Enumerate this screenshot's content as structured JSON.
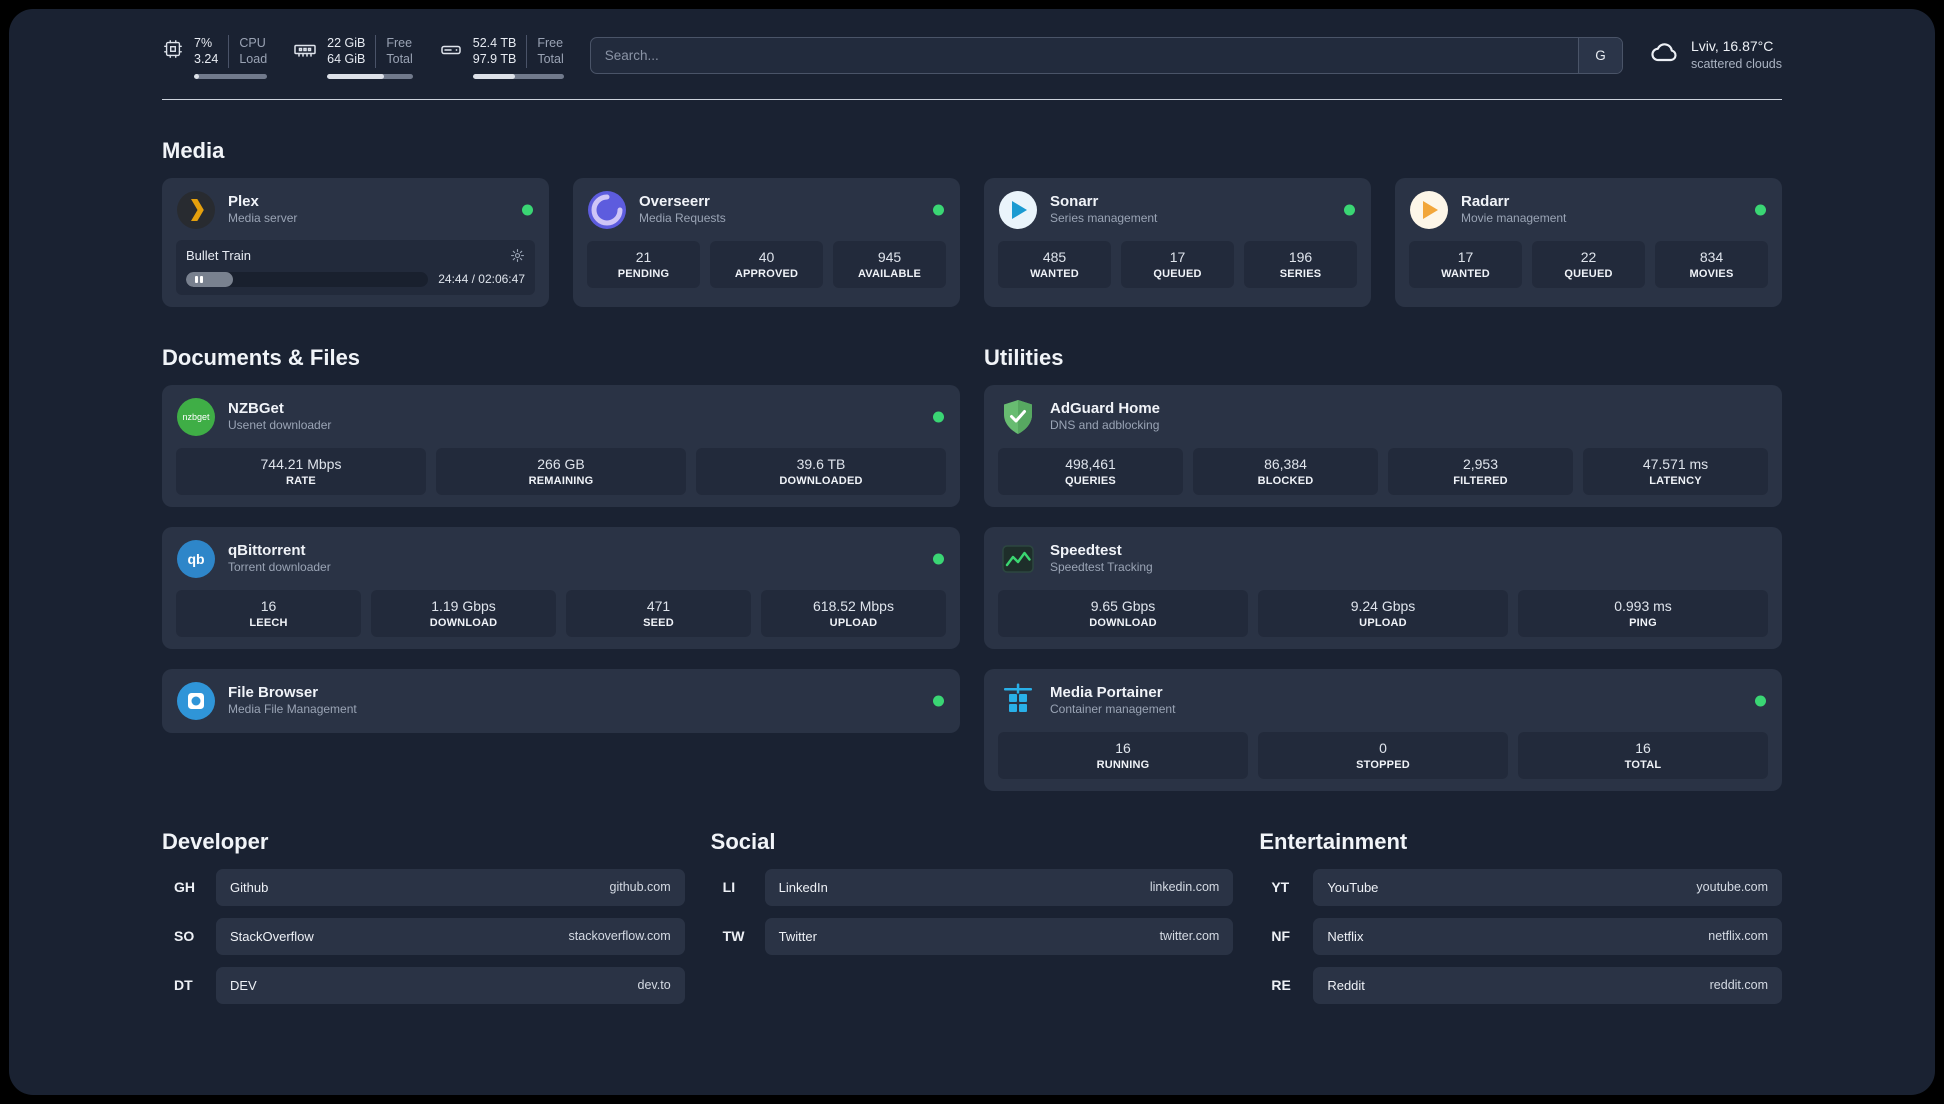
{
  "topbar": {
    "cpu": {
      "value1": "7%",
      "value2": "3.24",
      "label1": "CPU",
      "label2": "Load",
      "bar_percent": 7
    },
    "ram": {
      "value1": "22 GiB",
      "value2": "64 GiB",
      "label1": "Free",
      "label2": "Total",
      "bar_percent": 66
    },
    "disk": {
      "value1": "52.4 TB",
      "value2": "97.9 TB",
      "label1": "Free",
      "label2": "Total",
      "bar_percent": 46
    },
    "search": {
      "placeholder": "Search...",
      "button": "G"
    },
    "weather": {
      "location": "Lviv, 16.87°C",
      "condition": "scattered clouds"
    }
  },
  "sections": {
    "media": "Media",
    "documents": "Documents & Files",
    "utilities": "Utilities",
    "developer": "Developer",
    "social": "Social",
    "entertainment": "Entertainment"
  },
  "apps": {
    "plex": {
      "name": "Plex",
      "subtitle": "Media server",
      "now_playing": "Bullet Train",
      "time": "24:44 / 02:06:47",
      "progress_percent": 19.5
    },
    "overseerr": {
      "name": "Overseerr",
      "subtitle": "Media Requests",
      "stats": [
        {
          "value": "21",
          "label": "PENDING"
        },
        {
          "value": "40",
          "label": "APPROVED"
        },
        {
          "value": "945",
          "label": "AVAILABLE"
        }
      ]
    },
    "sonarr": {
      "name": "Sonarr",
      "subtitle": "Series management",
      "stats": [
        {
          "value": "485",
          "label": "WANTED"
        },
        {
          "value": "17",
          "label": "QUEUED"
        },
        {
          "value": "196",
          "label": "SERIES"
        }
      ]
    },
    "radarr": {
      "name": "Radarr",
      "subtitle": "Movie management",
      "stats": [
        {
          "value": "17",
          "label": "WANTED"
        },
        {
          "value": "22",
          "label": "QUEUED"
        },
        {
          "value": "834",
          "label": "MOVIES"
        }
      ]
    },
    "nzbget": {
      "name": "NZBGet",
      "subtitle": "Usenet downloader",
      "stats": [
        {
          "value": "744.21 Mbps",
          "label": "RATE"
        },
        {
          "value": "266 GB",
          "label": "REMAINING"
        },
        {
          "value": "39.6 TB",
          "label": "DOWNLOADED"
        }
      ]
    },
    "qbittorrent": {
      "name": "qBittorrent",
      "subtitle": "Torrent downloader",
      "stats": [
        {
          "value": "16",
          "label": "LEECH"
        },
        {
          "value": "1.19 Gbps",
          "label": "DOWNLOAD"
        },
        {
          "value": "471",
          "label": "SEED"
        },
        {
          "value": "618.52 Mbps",
          "label": "UPLOAD"
        }
      ]
    },
    "filebrowser": {
      "name": "File Browser",
      "subtitle": "Media File Management"
    },
    "adguard": {
      "name": "AdGuard Home",
      "subtitle": "DNS and adblocking",
      "stats": [
        {
          "value": "498,461",
          "label": "QUERIES"
        },
        {
          "value": "86,384",
          "label": "BLOCKED"
        },
        {
          "value": "2,953",
          "label": "FILTERED"
        },
        {
          "value": "47.571 ms",
          "label": "LATENCY"
        }
      ]
    },
    "speedtest": {
      "name": "Speedtest",
      "subtitle": "Speedtest Tracking",
      "stats": [
        {
          "value": "9.65 Gbps",
          "label": "DOWNLOAD"
        },
        {
          "value": "9.24 Gbps",
          "label": "UPLOAD"
        },
        {
          "value": "0.993 ms",
          "label": "PING"
        }
      ]
    },
    "portainer": {
      "name": "Media Portainer",
      "subtitle": "Container management",
      "stats": [
        {
          "value": "16",
          "label": "RUNNING"
        },
        {
          "value": "0",
          "label": "STOPPED"
        },
        {
          "value": "16",
          "label": "TOTAL"
        }
      ]
    }
  },
  "bookmarks": {
    "developer": [
      {
        "abbr": "GH",
        "name": "Github",
        "url": "github.com"
      },
      {
        "abbr": "SO",
        "name": "StackOverflow",
        "url": "stackoverflow.com"
      },
      {
        "abbr": "DT",
        "name": "DEV",
        "url": "dev.to"
      }
    ],
    "social": [
      {
        "abbr": "LI",
        "name": "LinkedIn",
        "url": "linkedin.com"
      },
      {
        "abbr": "TW",
        "name": "Twitter",
        "url": "twitter.com"
      }
    ],
    "entertainment": [
      {
        "abbr": "YT",
        "name": "YouTube",
        "url": "youtube.com"
      },
      {
        "abbr": "NF",
        "name": "Netflix",
        "url": "netflix.com"
      },
      {
        "abbr": "RE",
        "name": "Reddit",
        "url": "reddit.com"
      }
    ]
  },
  "colors": {
    "status_online": "#3ad674",
    "accent_plex": "#e5a00d",
    "accent_sonarr": "#1b9ad1",
    "accent_radarr": "#f2a63a",
    "accent_adguard": "#68bc71",
    "accent_speedtest_line": "#3bd671",
    "accent_portainer": "#29b0e8"
  }
}
